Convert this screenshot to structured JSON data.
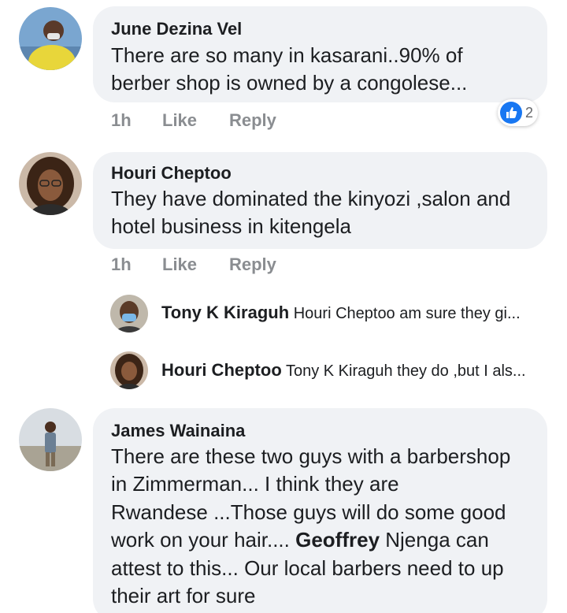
{
  "comments": [
    {
      "author": "June Dezina Vel",
      "lines": [
        "There are so many in kasarani..90% of",
        "berber shop is owned by a congolese..."
      ],
      "time": "1h",
      "like_label": "Like",
      "reply_label": "Reply",
      "reaction": {
        "icon": "thumbs-up-icon",
        "count": "2"
      }
    },
    {
      "author": "Houri Cheptoo",
      "lines": [
        "They have dominated the kinyozi ,salon and",
        "hotel business in kitengela"
      ],
      "time": "1h",
      "like_label": "Like",
      "reply_label": "Reply"
    },
    {
      "author": "James Wainaina",
      "lines": [
        "There are these two guys with a barbershop",
        "in Zimmerman... I think they are",
        "Rwandese ...Those guys will do some good"
      ],
      "line4_mention": "Geoffrey",
      "line4_rest": " Njenga can",
      "lines_end": [
        "attest to this... Our local barbers need to up",
        "their art for sure"
      ]
    }
  ],
  "replies": [
    {
      "author": "Tony K Kiraguh",
      "preview": "Houri Cheptoo am sure they gi..."
    },
    {
      "author": "Houri Cheptoo",
      "preview": "Tony K Kiraguh they do ,but I als..."
    }
  ],
  "colors": {
    "bubble": "#f0f2f5",
    "meta": "#8a8d91",
    "like_blue": "#1877f2"
  }
}
